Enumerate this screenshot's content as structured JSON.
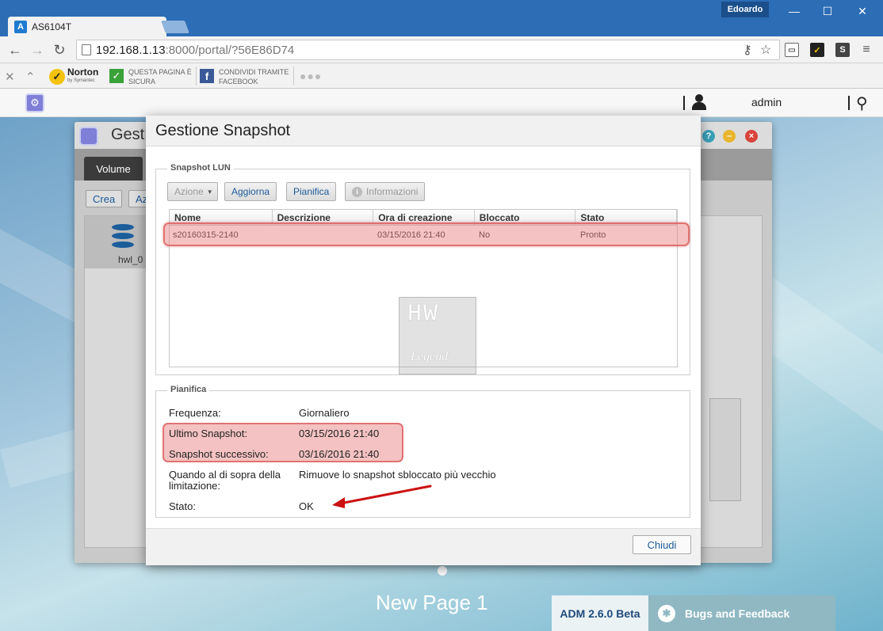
{
  "browser": {
    "tab_title": "AS6104T",
    "favicon": "A",
    "profile_name": "Edoardo",
    "url_host": "192.168.1.13",
    "url_rest": ":8000/portal/?56E86D74",
    "win_minimize": "—",
    "win_maximize": "☐",
    "win_close": "✕"
  },
  "extensions": {
    "norton_brand": "Norton",
    "norton_sub": "by Symantec",
    "safe_line1": "QUESTA PAGINA È",
    "safe_line2": "SICURA",
    "fb_line1": "CONDIVIDI TRAMITE",
    "fb_line2": "FACEBOOK"
  },
  "adm": {
    "username": "admin",
    "page_name": "New Page 1",
    "version": "ADM 2.6.0 Beta",
    "bugs_label": "Bugs and Feedback"
  },
  "storage_window": {
    "title": "Gest",
    "tab": "Volume",
    "create_btn": "Crea",
    "action_btn": "Az",
    "volume_label": "hwl_0"
  },
  "modal": {
    "title": "Gestione Snapshot",
    "lun_legend": "Snapshot LUN",
    "toolbar": {
      "action": "Azione",
      "refresh": "Aggiorna",
      "schedule": "Pianifica",
      "info": "Informazioni"
    },
    "columns": [
      "Nome",
      "Descrizione",
      "Ora di creazione",
      "Bloccato",
      "Stato"
    ],
    "rows": [
      [
        "s20160315-2140",
        "",
        "03/15/2016 21:40",
        "No",
        "Pronto"
      ]
    ],
    "watermark_top": "HW",
    "watermark_bottom": "Legend",
    "schedule_legend": "Pianifica",
    "schedule": {
      "freq_label": "Frequenza:",
      "freq_value": "Giornaliero",
      "last_label": "Ultimo Snapshot:",
      "last_value": "03/15/2016 21:40",
      "next_label": "Snapshot successivo:",
      "next_value": "03/16/2016 21:40",
      "limit_label_1": "Quando al di sopra della",
      "limit_label_2": "limitazione:",
      "limit_value": "Rimuove lo snapshot sbloccato più vecchio",
      "status_label": "Stato:",
      "status_value": "OK"
    },
    "close_btn": "Chiudi"
  },
  "colors": {
    "highlight": "#e67878",
    "accent_blue": "#1a5a9a",
    "arrow_red": "#cc1111"
  }
}
